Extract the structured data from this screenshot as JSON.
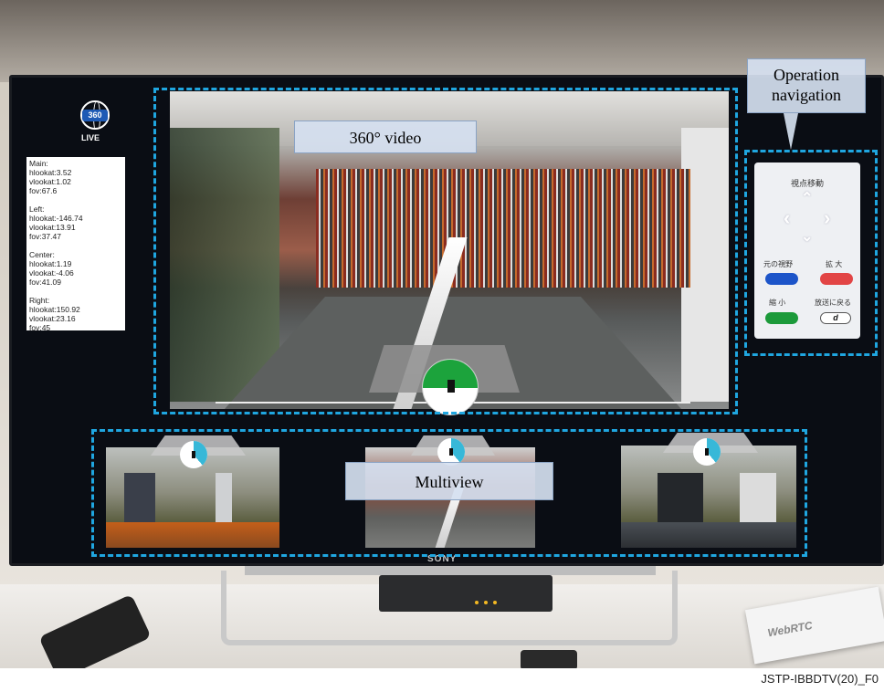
{
  "labels": {
    "video_360": "360° video",
    "multiview": "Multiview",
    "operation_navigation_line1": "Operation",
    "operation_navigation_line2": "navigation"
  },
  "live_logo": {
    "badge": "360",
    "text": "LIVE"
  },
  "info_panel": [
    "Main:",
    "hlookat:3.52",
    "vlookat:1.02",
    "fov:67.6",
    "",
    "Left:",
    "hlookat:-146.74",
    "vlookat:13.91",
    "fov:37.47",
    "",
    "Center:",
    "hlookat:1.19",
    "vlookat:-4.06",
    "fov:41.09",
    "",
    "Right:",
    "hlookat:150.92",
    "vlookat:23.16",
    "fov:45"
  ],
  "nav_panel": {
    "title": "視点移動",
    "arrows": {
      "up": "⌃",
      "down": "⌄",
      "left": "‹",
      "right": "›"
    },
    "reset_label": "元の視野",
    "zoom_in_label": "拡 大",
    "zoom_out_label": "縮 小",
    "return_label": "放送に戻る",
    "d_button": "d",
    "colors": {
      "reset": "#1d55c9",
      "zoom_in": "#e24545",
      "zoom_out": "#1c9a3a",
      "return": "#ffffff"
    }
  },
  "tv_brand": "SONY",
  "figure_id": "JSTP-IBBDTV(20)_F0",
  "colors": {
    "dash": "#1fa6e0",
    "label_bg": "#d5e0f0"
  }
}
